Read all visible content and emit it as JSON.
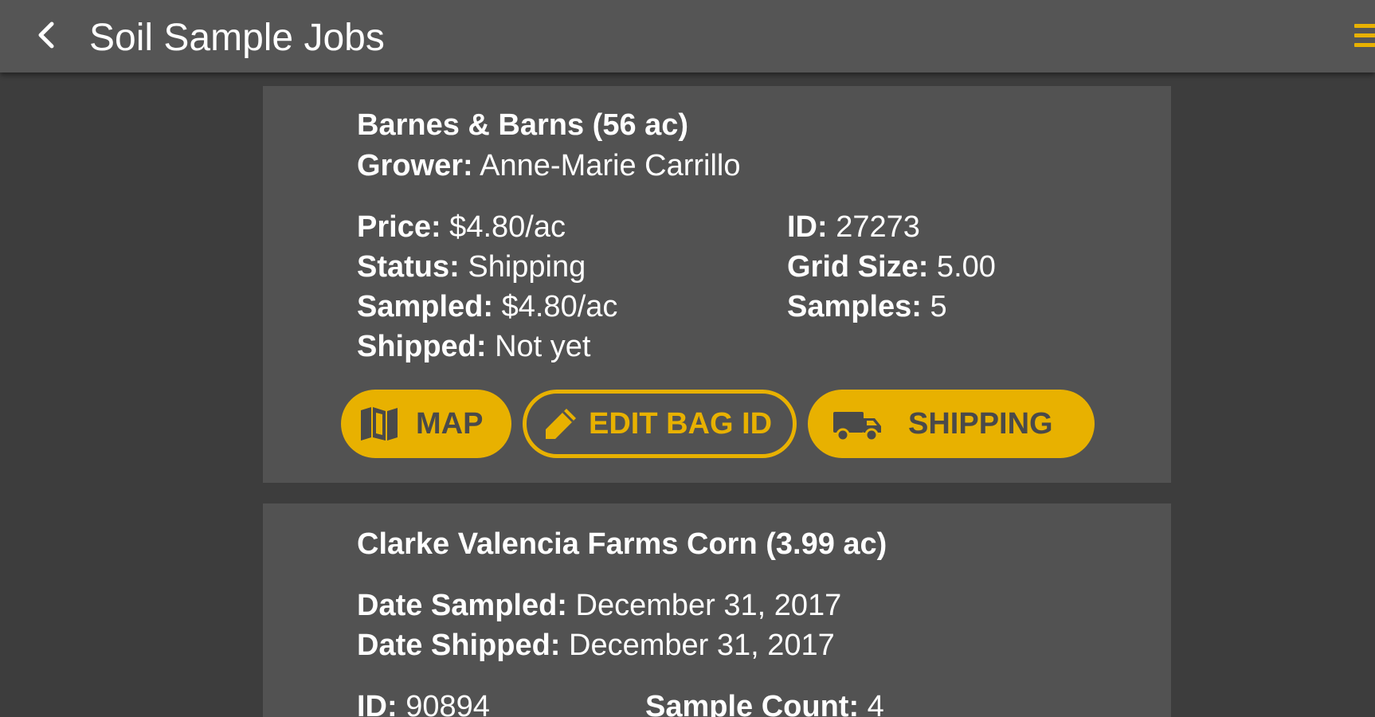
{
  "appbar": {
    "title": "Soil Sample Jobs",
    "back_icon": "chevron-left-icon",
    "menu_icon": "menu-icon"
  },
  "colors": {
    "accent": "#e8b100",
    "appbar_bg": "#555555",
    "background": "#3d3d3d",
    "card_bg": "#525252"
  },
  "jobs": [
    {
      "heading": "Barnes & Barns  (56 ac)",
      "grower_label": "Grower:",
      "grower_value": " Anne-Marie Carrillo",
      "fields_left": [
        {
          "label": "Price:",
          "value": " $4.80/ac"
        },
        {
          "label": "Status:",
          "value": " Shipping"
        },
        {
          "label": "Sampled:",
          "value": " $4.80/ac"
        },
        {
          "label": "Shipped:",
          "value": " Not yet"
        }
      ],
      "fields_right": [
        {
          "label": "ID:",
          "value": " 27273"
        },
        {
          "label": "Grid Size:",
          "value": " 5.00"
        },
        {
          "label": "Samples:",
          "value": " 5"
        }
      ],
      "actions": [
        {
          "label": "MAP",
          "icon": "map-icon",
          "style": "filled"
        },
        {
          "label": "EDIT BAG ID",
          "icon": "pencil-icon",
          "style": "outline"
        },
        {
          "label": "SHIPPING",
          "icon": "truck-icon",
          "style": "filled"
        }
      ]
    },
    {
      "heading": "Clarke Valencia Farms  Corn (3.99 ac)",
      "fields": [
        {
          "label": "Date Sampled:",
          "value": " December 31, 2017"
        },
        {
          "label": "Date Shipped:",
          "value": " December 31, 2017"
        }
      ],
      "id_label": "ID:",
      "id_value": " 90894",
      "count_label": "Sample Count:",
      "count_value": " 4"
    }
  ]
}
